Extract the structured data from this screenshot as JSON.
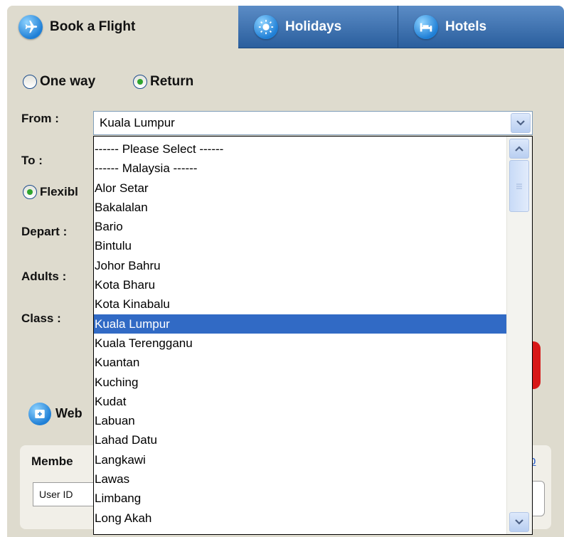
{
  "tabs": {
    "flight": {
      "label": "Book a Flight",
      "icon": "airplane-icon"
    },
    "holidays": {
      "label": "Holidays",
      "icon": "sun-icon"
    },
    "hotels": {
      "label": "Hotels",
      "icon": "bed-icon"
    }
  },
  "trip_type": {
    "one_way": "One way",
    "return": "Return",
    "selected": "Return"
  },
  "form": {
    "from_label": "From :",
    "from_value": "Kuala Lumpur",
    "to_label": "To :",
    "flexible_label": "Flexibl",
    "depart_label": "Depart :",
    "adults_label": "Adults :",
    "class_label": "Class :",
    "web_label": "Web"
  },
  "member": {
    "label": "Membe",
    "userid_placeholder": "User ID",
    "link_text": "p"
  },
  "dropdown": {
    "selected": "Kuala Lumpur",
    "options": [
      "------ Please Select ------",
      "------ Malaysia ------",
      "Alor Setar",
      "Bakalalan",
      "Bario",
      "Bintulu",
      "Johor Bahru",
      "Kota Bharu",
      "Kota Kinabalu",
      "Kuala Lumpur",
      "Kuala Terengganu",
      "Kuantan",
      "Kuching",
      "Kudat",
      "Labuan",
      "Lahad Datu",
      "Langkawi",
      "Lawas",
      "Limbang",
      "Long Akah"
    ]
  },
  "colors": {
    "panel": "#dedbce",
    "tab_blue": "#2a5e9d",
    "selection": "#316ac5",
    "radio_check": "#2fa52f"
  }
}
